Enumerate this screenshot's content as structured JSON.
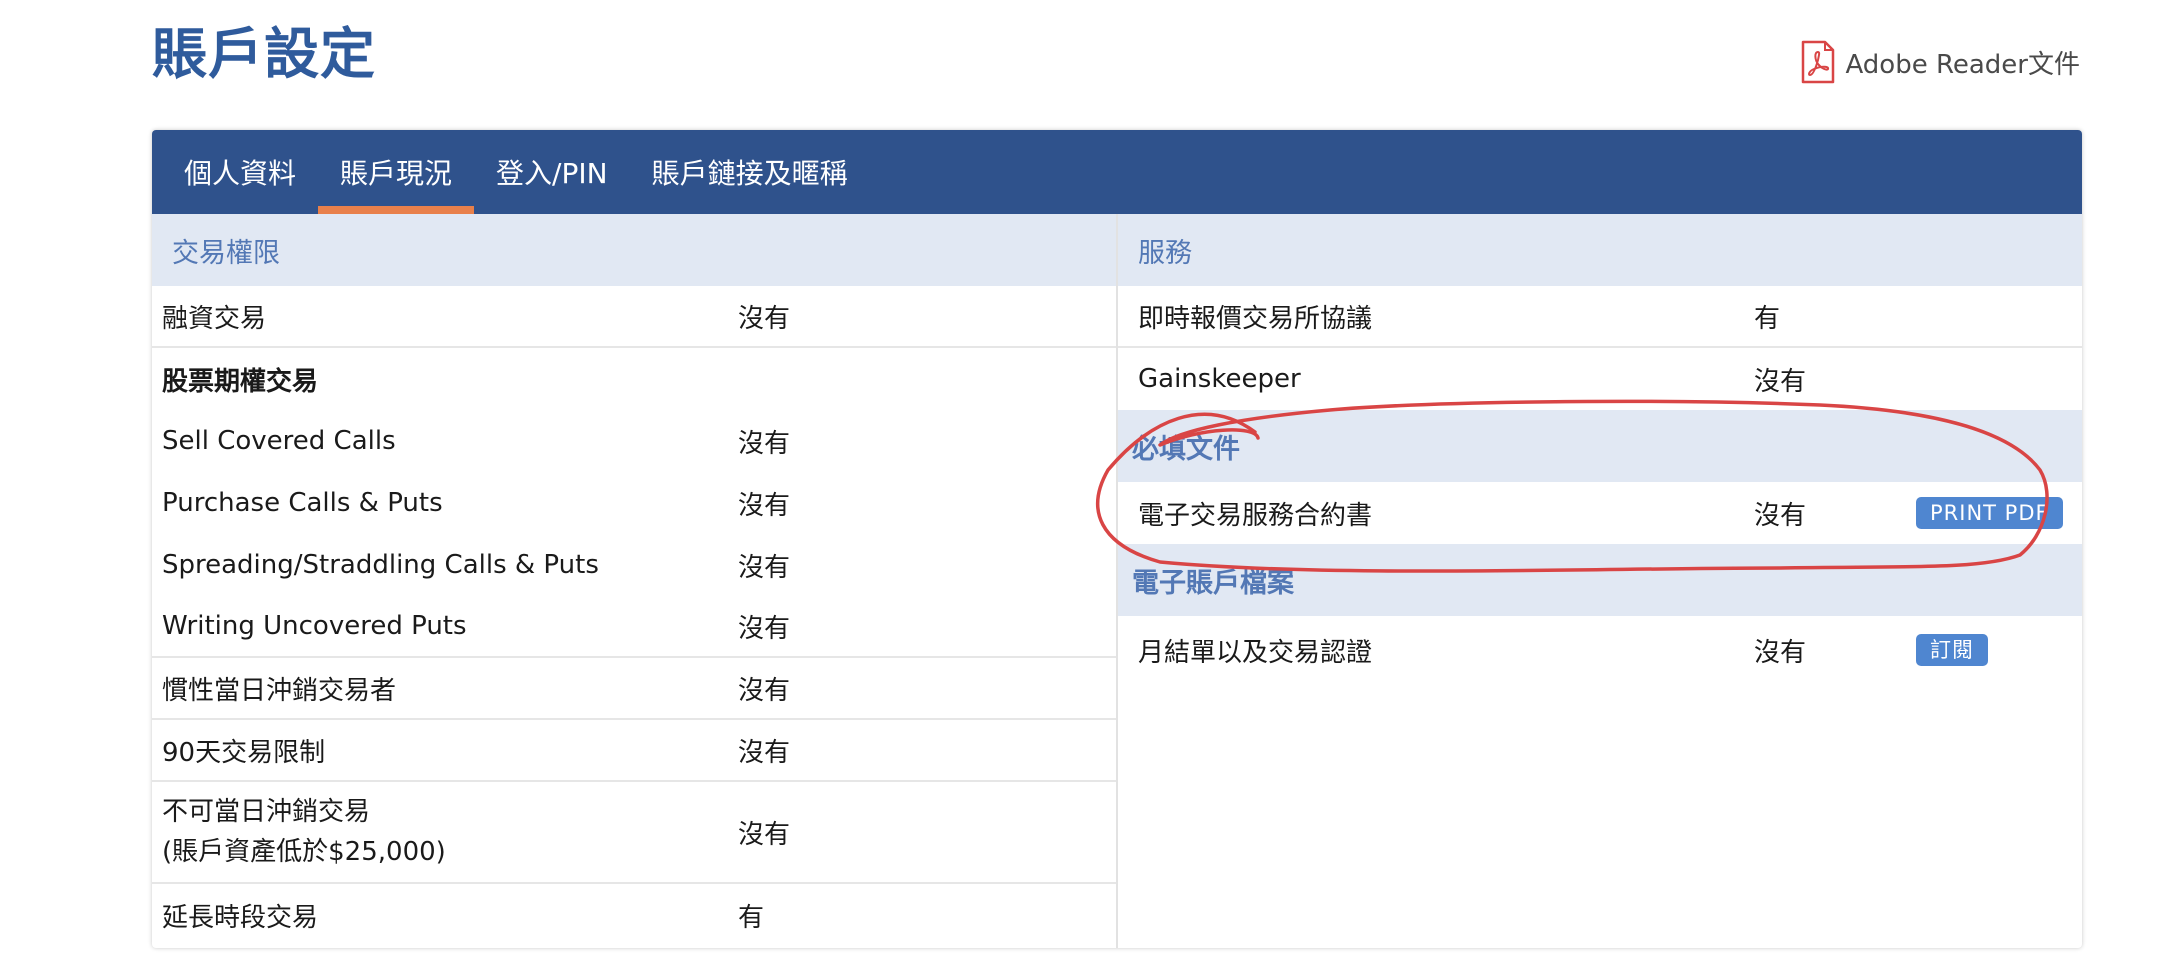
{
  "page": {
    "title": "賬戶設定"
  },
  "pdf_link": {
    "label": "Adobe Reader文件",
    "icon": "pdf-icon"
  },
  "tabs": [
    {
      "label": "個人資料",
      "active": false
    },
    {
      "label": "賬戶現況",
      "active": true
    },
    {
      "label": "登入/PIN",
      "active": false
    },
    {
      "label": "賬戶鏈接及暱稱",
      "active": false
    }
  ],
  "left": {
    "header": "交易權限",
    "rows": [
      {
        "label": "融資交易",
        "value": "沒有"
      },
      {
        "label": "股票期權交易",
        "value": ""
      },
      {
        "label": "Sell Covered Calls",
        "value": "沒有"
      },
      {
        "label": "Purchase Calls & Puts",
        "value": "沒有"
      },
      {
        "label": "Spreading/Straddling Calls & Puts",
        "value": "沒有"
      },
      {
        "label": "Writing Uncovered Puts",
        "value": "沒有"
      },
      {
        "label": "慣性當日沖銷交易者",
        "value": "沒有"
      },
      {
        "label": "90天交易限制",
        "value": "沒有"
      },
      {
        "label": "不可當日沖銷交易",
        "label2": "(賬戶資產低於$25,000)",
        "value": "沒有"
      },
      {
        "label": "延長時段交易",
        "value": "有"
      }
    ]
  },
  "right": {
    "services_header": "服務",
    "services": [
      {
        "label": "即時報價交易所協議",
        "value": "有"
      },
      {
        "label": "Gainskeeper",
        "value": "沒有"
      }
    ],
    "required_header": "必填文件",
    "required": [
      {
        "label": "電子交易服務合約書",
        "value": "沒有",
        "button": "PRINT PDF"
      }
    ],
    "estatement_header": "電子賬戶檔案",
    "estatements": [
      {
        "label": "月結單以及交易認證",
        "value": "沒有",
        "button": "訂閱"
      }
    ]
  },
  "colors": {
    "brand": "#2f528c",
    "title": "#2f5b9c",
    "tab_active_underline": "#e8804b",
    "section_bg": "#e1e8f3",
    "section_text": "#5378b5",
    "button": "#4f86d0",
    "annotation": "#d94545"
  }
}
